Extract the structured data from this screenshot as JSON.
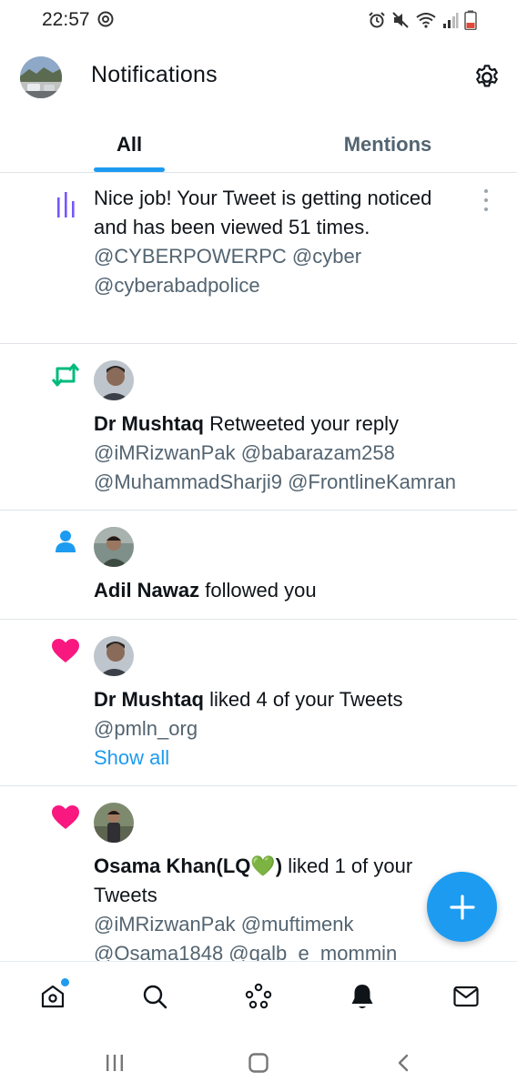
{
  "status_bar": {
    "time": "22:57"
  },
  "header": {
    "title": "Notifications"
  },
  "tabs": [
    {
      "label": "All",
      "active": true
    },
    {
      "label": "Mentions",
      "active": false
    }
  ],
  "notifications": [
    {
      "type": "tweet-views",
      "icon": "analytics-bars-icon",
      "text": "Nice job! Your Tweet is getting noticed and has been viewed 51 times.",
      "mentions_line1": "@CYBERPOWERPC @cyber",
      "mentions_line2": "@cyberabadpolice"
    },
    {
      "type": "retweet",
      "icon": "retweet-icon",
      "actor": "Dr Mushtaq",
      "action": " Retweeted your reply",
      "mentions_line1": "@iMRizwanPak @babarazam258",
      "mentions_line2": "@MuhammadSharji9 @FrontlineKamran"
    },
    {
      "type": "follow",
      "icon": "person-icon",
      "actor": "Adil Nawaz",
      "action": " followed you"
    },
    {
      "type": "like",
      "icon": "heart-icon",
      "actor": "Dr Mushtaq",
      "action": " liked 4 of your Tweets",
      "mentions_line1": "@pmln_org",
      "show_all": "Show all"
    },
    {
      "type": "like",
      "icon": "heart-icon",
      "actor": "Osama Khan(LQ",
      "actor_emoji": "💚",
      "actor_close": ")",
      "action": " liked 1 of your",
      "action_line2": "Tweets",
      "mentions_line1": "@iMRizwanPak @muftimenk",
      "mentions_line2": "@Osama1848 @qalb_e_mommin"
    }
  ],
  "colors": {
    "accent": "#1d9bf0",
    "like": "#f91880",
    "retweet": "#00ba7c",
    "analytics": "#7856ff",
    "text_primary": "#0f1419",
    "text_secondary": "#536471"
  },
  "bottom_nav": [
    {
      "name": "home",
      "has_badge": true
    },
    {
      "name": "search"
    },
    {
      "name": "spaces"
    },
    {
      "name": "notifications",
      "active": true
    },
    {
      "name": "messages"
    }
  ]
}
